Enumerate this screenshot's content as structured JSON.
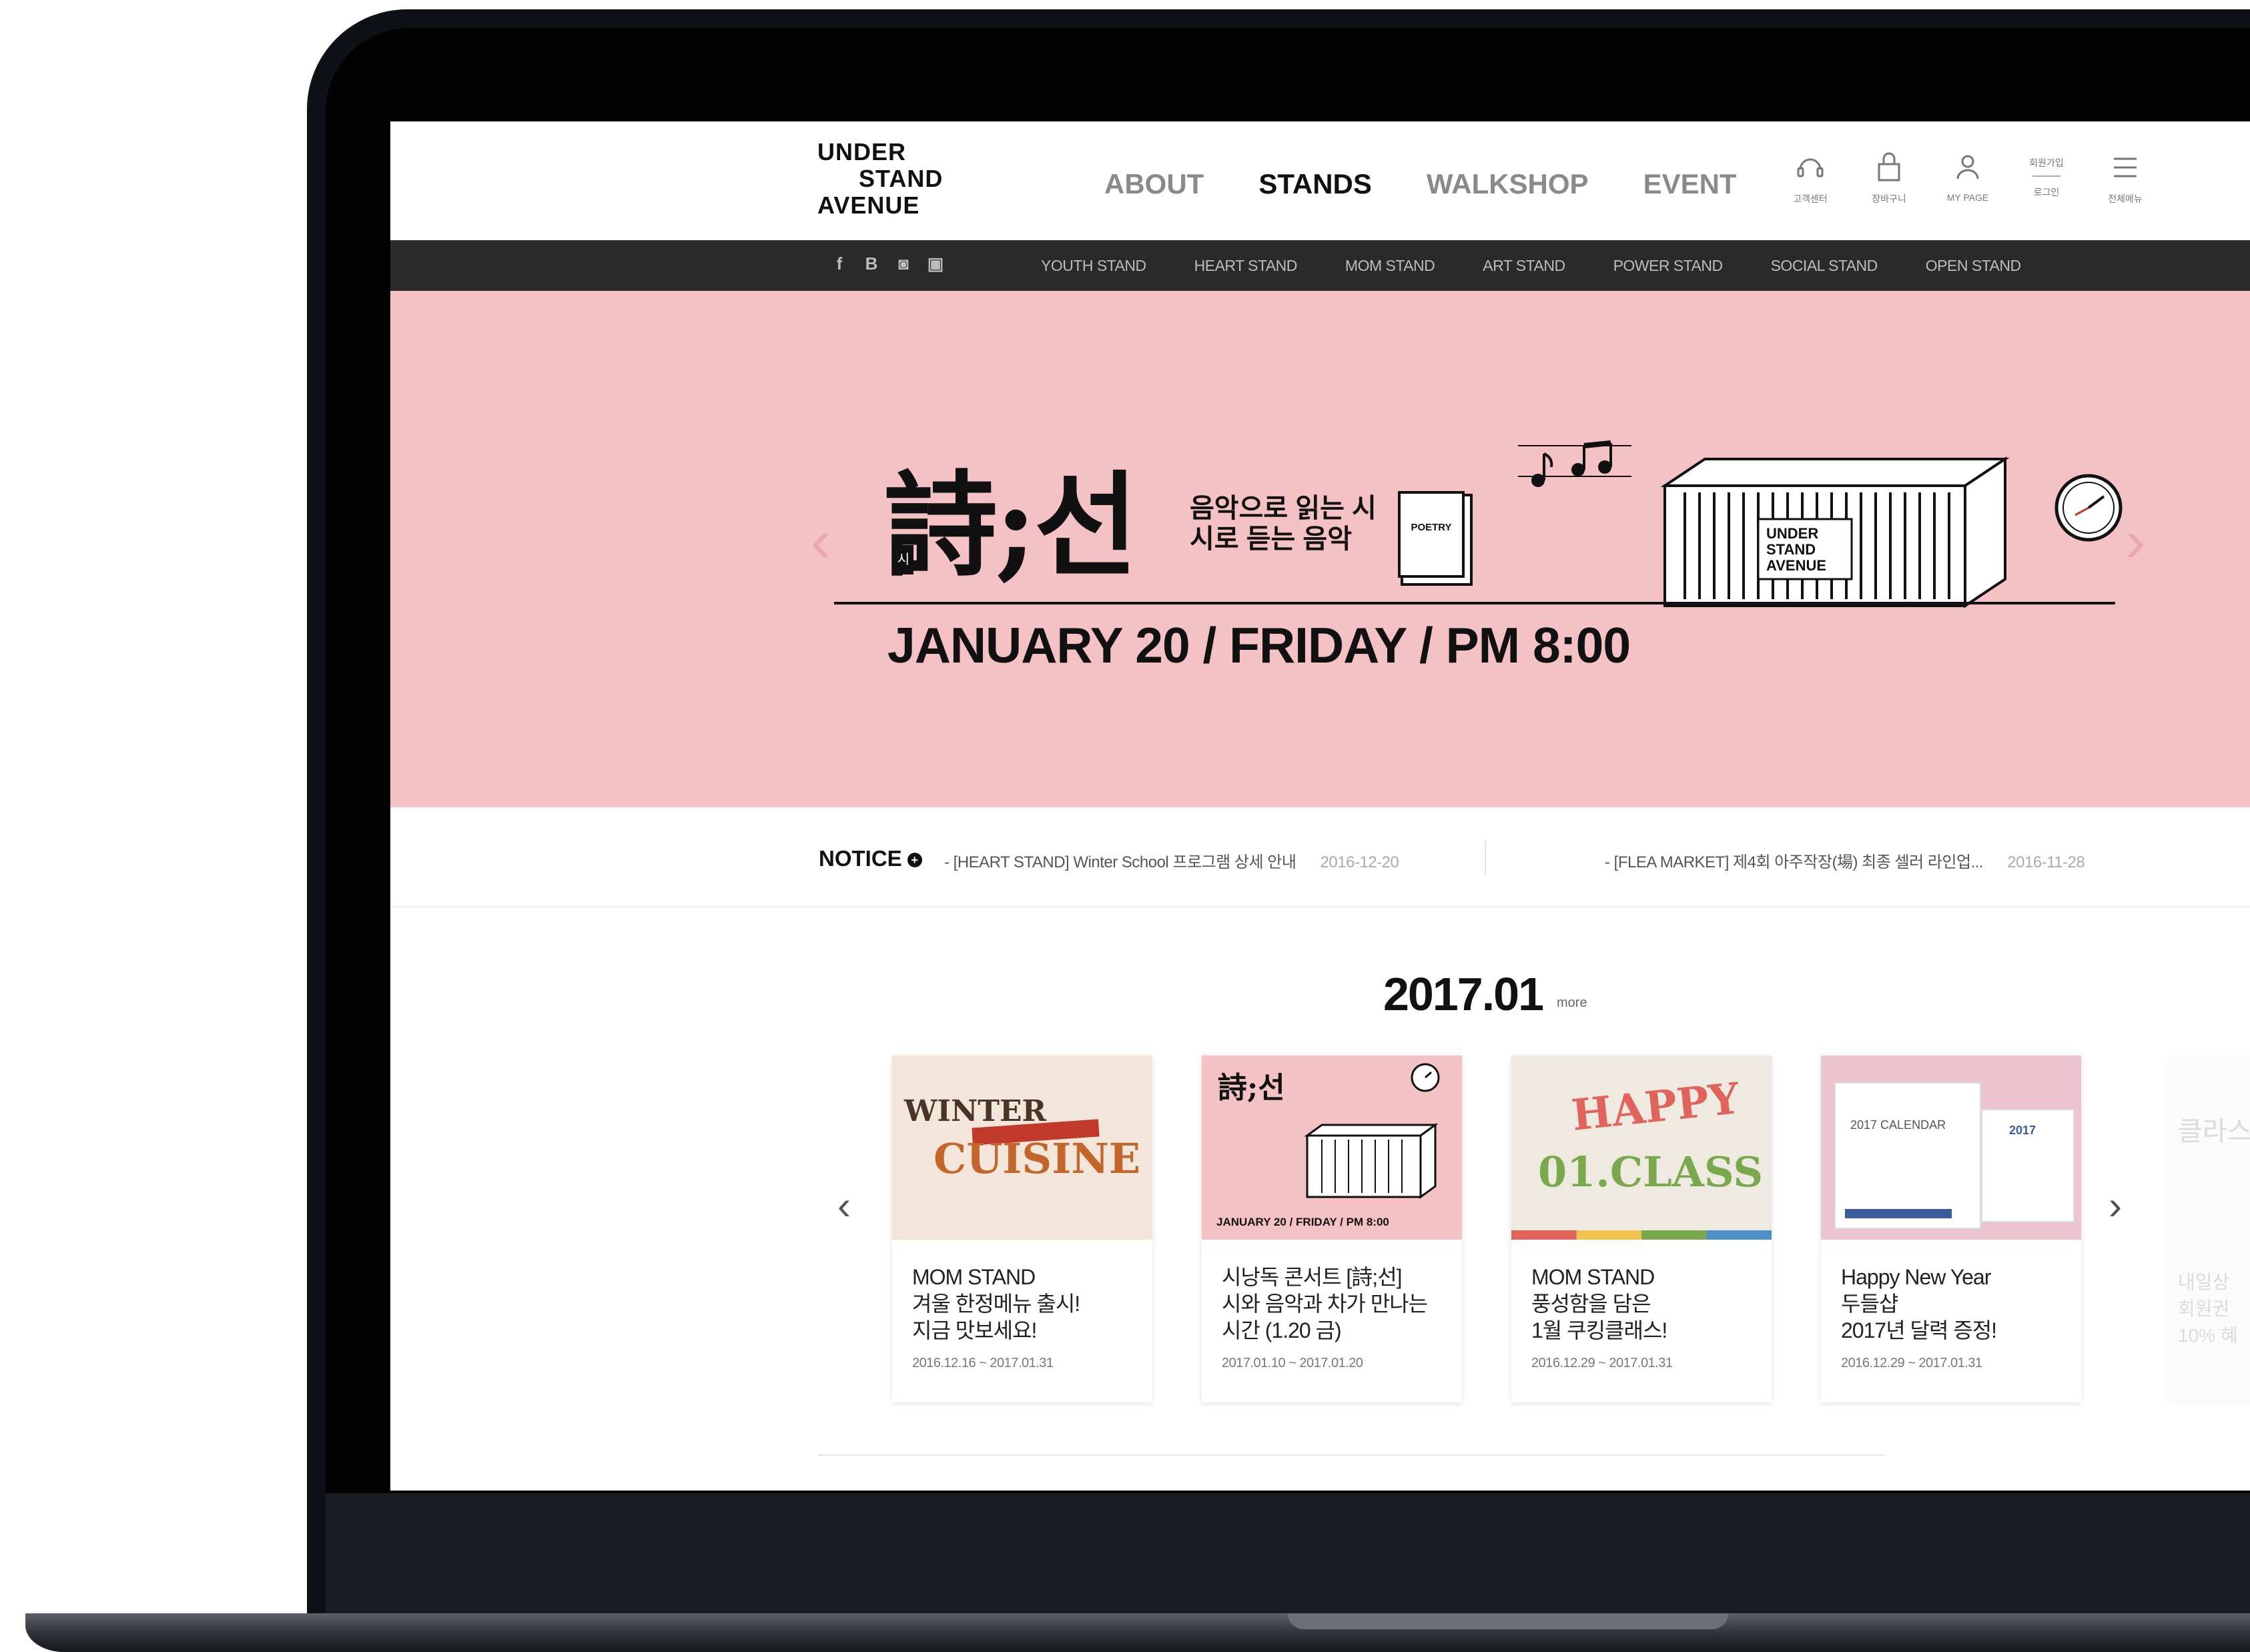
{
  "logo": {
    "line1": "UNDER",
    "line2": "STAND",
    "line3": "AVENUE"
  },
  "gnb": [
    {
      "label": "ABOUT",
      "active": false
    },
    {
      "label": "STANDS",
      "active": true
    },
    {
      "label": "WALKSHOP",
      "active": false
    },
    {
      "label": "EVENT",
      "active": false
    }
  ],
  "util": {
    "top_label": "회원가입",
    "items": [
      {
        "icon": "headset-icon",
        "label": "고객센터"
      },
      {
        "icon": "bag-icon",
        "label": "장바구니"
      },
      {
        "icon": "user-icon",
        "label": "MY PAGE"
      },
      {
        "icon": "login-icon",
        "label": "로그인"
      },
      {
        "icon": "menu-icon",
        "label": "전체메뉴"
      }
    ]
  },
  "social": [
    "f",
    "B",
    "◙",
    "▣"
  ],
  "stands": [
    "YOUTH STAND",
    "HEART STAND",
    "MOM STAND",
    "ART STAND",
    "POWER STAND",
    "SOCIAL STAND",
    "OPEN STAND"
  ],
  "hero": {
    "title": "詩;선",
    "title_badge": "시",
    "subtitle_line1": "음악으로 읽는 시",
    "subtitle_line2": "시로 듣는 음악",
    "book_label": "POETRY",
    "container_label": "UNDER STAND AVENUE",
    "date": "JANUARY 20 / FRIDAY / PM 8:00",
    "slides_total": 5,
    "slide_active": 1
  },
  "notice": {
    "label": "NOTICE",
    "items": [
      {
        "text": "- [HEART STAND] Winter School 프로그램 상세 안내",
        "date": "2016-12-20"
      },
      {
        "text": "- [FLEA MARKET] 제4회 아주작장(場) 최종 셀러 라인업...",
        "date": "2016-11-28"
      }
    ]
  },
  "month": {
    "title": "2017.01",
    "more": "more"
  },
  "cards": [
    {
      "title": "MOM STAND\n겨울 한정메뉴 출시!\n지금 맛보세요!",
      "date": "2016.12.16 ~ 2017.01.31",
      "thumb_text_1": "WINTER",
      "thumb_text_2": "CUISINE"
    },
    {
      "title": "시낭독 콘서트 [詩;선]\n시와 음악과 차가 만나는\n시간 (1.20 금)",
      "date": "2017.01.10 ~ 2017.01.20",
      "thumb_text_1": "詩;선",
      "thumb_text_2": "JANUARY 20 / FRIDAY / PM 8:00"
    },
    {
      "title": "MOM STAND\n풍성함을 담은\n1월 쿠킹클래스!",
      "date": "2016.12.29 ~ 2017.01.31",
      "thumb_text_1": "HAPPY",
      "thumb_text_2": "01.CLASS"
    },
    {
      "title": "Happy New Year\n두들샵\n2017년 달력 증정!",
      "date": "2016.12.29 ~ 2017.01.31",
      "thumb_text_1": "2017 CALENDAR",
      "thumb_text_2": "2017"
    }
  ],
  "ghost_card": {
    "title": "클라스",
    "body": "내일상\n회원권\n10% 혜"
  },
  "colors": {
    "hero_bg": "#f4c2c4",
    "accent": "#f36f2b",
    "subnav_bg": "#2a2a2a"
  }
}
